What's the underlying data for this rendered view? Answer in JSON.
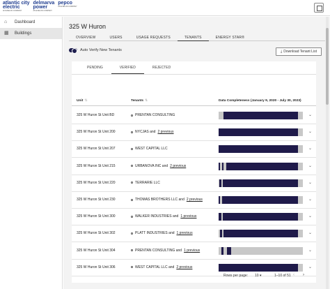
{
  "header": {
    "logos": [
      {
        "name": "atlantic city electric",
        "line1": "atlantic city",
        "line2": "electric",
        "sub": "AN EXELON COMPANY"
      },
      {
        "name": "delmarva power",
        "line1": "delmarva",
        "line2": "power",
        "sub": "AN EXELON COMPANY"
      },
      {
        "name": "pepco",
        "line1": "pepco",
        "line2": "",
        "sub": "AN EXELON COMPANY"
      }
    ]
  },
  "sidebar": {
    "items": [
      {
        "label": "Dashboard",
        "icon": "home-icon",
        "active": false
      },
      {
        "label": "Buildings",
        "icon": "building-icon",
        "active": true
      }
    ]
  },
  "page": {
    "title": "325 W Huron",
    "tabs": [
      "OVERVIEW",
      "USERS",
      "USAGE REQUESTS",
      "TENANTS",
      "ENERGY STAR®"
    ],
    "active_tab": "TENANTS",
    "toggle_label": "Auto Verify New Tenants",
    "download_label": "Download Tenant List"
  },
  "subtabs": [
    "PENDING",
    "VERIFIED",
    "REJECTED"
  ],
  "active_subtab": "VERIFIED",
  "table": {
    "headers": {
      "unit": "Unit",
      "tenants": "Tenants",
      "completeness": "Data Completeness (January 9, 2020 - July 30, 2023)"
    },
    "rows": [
      {
        "unit": "325 W Huron St Unit BD",
        "tenant": "PRENTAN CONSULTING",
        "more": "",
        "gaps": [
          [
            0,
            0.06
          ],
          [
            0.94,
            1
          ]
        ]
      },
      {
        "unit": "325 W Huron St Unit 200",
        "tenant": "NYCJAS and",
        "more": "2 previous",
        "gaps": [
          [
            0.94,
            1
          ]
        ]
      },
      {
        "unit": "325 W Huron St Unit 207",
        "tenant": "WEST CAPITAL LLC",
        "more": "",
        "gaps": [
          [
            0.94,
            1
          ]
        ]
      },
      {
        "unit": "325 W Huron St Unit 215",
        "tenant": "URBANOVA INC and",
        "more": "2 previous",
        "gaps": [
          [
            0.02,
            0.04
          ],
          [
            0.06,
            0.09
          ],
          [
            0.94,
            1
          ]
        ]
      },
      {
        "unit": "325 W Huron St Unit 220",
        "tenant": "TERRARIE LLC",
        "more": "",
        "gaps": [
          [
            0,
            0.01
          ],
          [
            0.03,
            0.05
          ],
          [
            0.94,
            1
          ]
        ]
      },
      {
        "unit": "325 W Huron St Unit 230",
        "tenant": "THOMAS BROTHERS LLC and",
        "more": "2 previous",
        "gaps": [
          [
            0.02,
            0.04
          ],
          [
            0.94,
            1
          ]
        ]
      },
      {
        "unit": "325 W Huron St Unit 300",
        "tenant": "WALKER INDUSTRIES and",
        "more": "1 previous",
        "gaps": [
          [
            0.03,
            0.05
          ],
          [
            0.94,
            1
          ]
        ]
      },
      {
        "unit": "325 W Huron St Unit 302",
        "tenant": "PLATT INDUSTRIES and",
        "more": "1 previous",
        "gaps": [
          [
            0,
            0.02
          ],
          [
            0.04,
            0.06
          ],
          [
            0.94,
            1
          ]
        ]
      },
      {
        "unit": "325 W Huron St Unit 304",
        "tenant": "PRENTAN CONSULTING and",
        "more": "1 previous",
        "gaps": [
          [
            0,
            0.03
          ],
          [
            0.06,
            0.1
          ],
          [
            0.15,
            1
          ]
        ]
      },
      {
        "unit": "325 W Huron St Unit 306",
        "tenant": "WEST CAPITAL LLC and",
        "more": "2 previous",
        "gaps": [
          [
            0.94,
            1
          ]
        ]
      }
    ]
  },
  "pagination": {
    "rows_label": "Rows per page:",
    "rows_value": "10",
    "range": "1–10 of 51"
  },
  "colors": {
    "bar_fill": "#1f1a4a",
    "bar_gap": "#c8c8c8"
  }
}
